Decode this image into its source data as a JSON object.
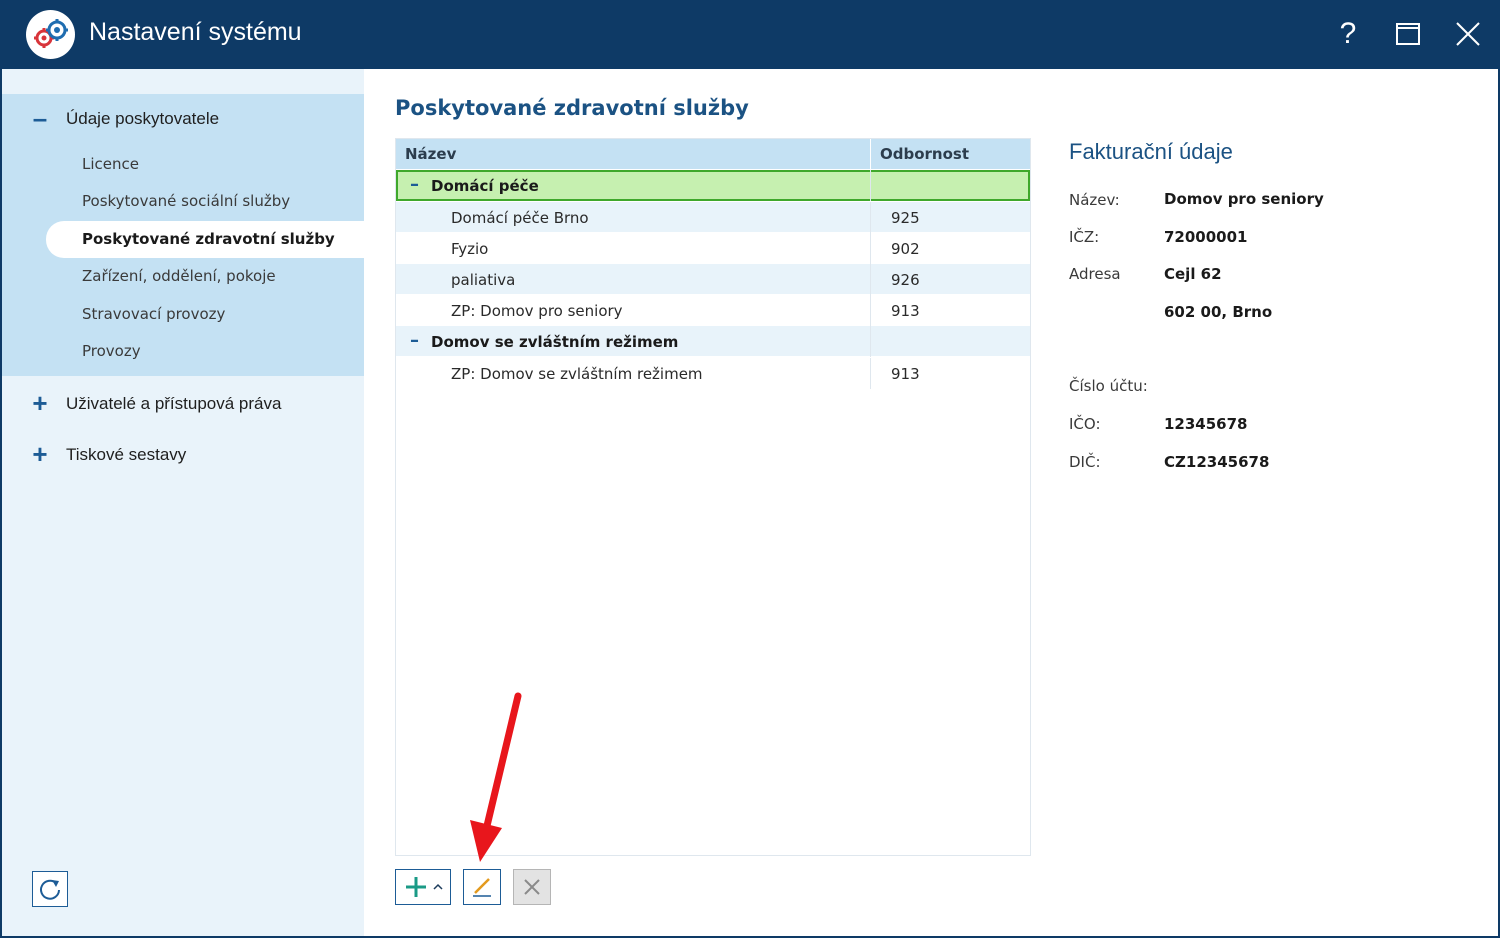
{
  "window": {
    "title": "Nastavení systému",
    "help_label": "?"
  },
  "sidebar": {
    "groups": [
      {
        "label": "Údaje poskytovatele",
        "expanded": true,
        "items": [
          {
            "label": "Licence"
          },
          {
            "label": "Poskytované sociální služby"
          },
          {
            "label": "Poskytované zdravotní služby",
            "active": true
          },
          {
            "label": "Zařízení, oddělení, pokoje"
          },
          {
            "label": "Stravovací provozy"
          },
          {
            "label": "Provozy"
          }
        ]
      },
      {
        "label": "Uživatelé a přístupová práva",
        "expanded": false
      },
      {
        "label": "Tiskové sestavy",
        "expanded": false
      }
    ]
  },
  "main": {
    "title": "Poskytované zdravotní služby",
    "table": {
      "columns": [
        "Název",
        "Odbornost"
      ],
      "groups": [
        {
          "name": "Domácí péče",
          "selected": true,
          "rows": [
            {
              "name": "Domácí péče Brno",
              "odbornost": "925"
            },
            {
              "name": "Fyzio",
              "odbornost": "902"
            },
            {
              "name": "paliativa",
              "odbornost": "926"
            },
            {
              "name": "ZP: Domov pro seniory",
              "odbornost": "913"
            }
          ]
        },
        {
          "name": "Domov se zvláštním režimem",
          "selected": false,
          "rows": [
            {
              "name": "ZP: Domov se zvláštním režimem",
              "odbornost": "913"
            }
          ]
        }
      ]
    }
  },
  "billing": {
    "title": "Fakturační údaje",
    "nazev_label": "Název:",
    "nazev_value": "Domov pro seniory",
    "icz_label": "IČZ:",
    "icz_value": "72000001",
    "adresa_label": "Adresa",
    "adresa_line1": "Cejl 62",
    "adresa_line2": "602 00, Brno",
    "ucet_label": "Číslo účtu:",
    "ico_label": "IČO:",
    "ico_value": "12345678",
    "dic_label": "DIČ:",
    "dic_value": "CZ12345678"
  },
  "toolbar": {
    "add_icon": "plus-icon",
    "edit_icon": "pencil-icon",
    "delete_icon": "close-icon"
  },
  "colors": {
    "titlebar": "#0e3a66",
    "accent": "#1b5283",
    "selected_row": "#c6f0b0",
    "selected_border": "#3fa82b",
    "annotation_arrow": "#e8161c"
  }
}
